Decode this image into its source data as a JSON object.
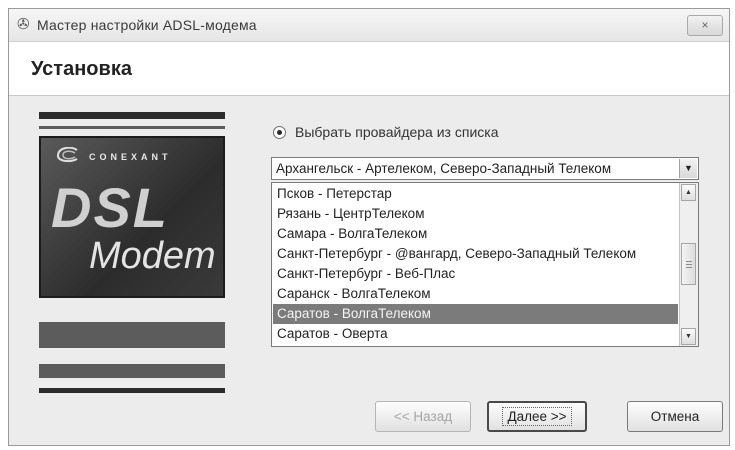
{
  "window": {
    "title": "Мастер настройки ADSL-модема",
    "close_label": "×"
  },
  "header": {
    "title": "Установка"
  },
  "logo": {
    "brand": "CONEXANT",
    "line1": "DSL",
    "line2": "Modem"
  },
  "provider": {
    "radio_label": "Выбрать провайдера из списка",
    "selected_combo": "Архангельск - Артелеком, Северо-Западный Телеком",
    "items": [
      "Псков - Петерстар",
      "Рязань - ЦентрТелеком",
      "Самара - ВолгаТелеком",
      "Санкт-Петербург - @вангард, Северо-Западный Телеком",
      "Санкт-Петербург - Веб-Плас",
      "Саранск - ВолгаТелеком",
      "Саратов - ВолгаТелеком",
      "Саратов - Оверта"
    ],
    "selected_index": 6
  },
  "buttons": {
    "back": "<< Назад",
    "next": "Далее >>",
    "cancel": "Отмена"
  },
  "icons": {
    "app": "wizard-icon",
    "combo_arrow": "chevron-down-icon",
    "scroll_up": "scroll-up-icon",
    "scroll_down": "scroll-down-icon"
  }
}
